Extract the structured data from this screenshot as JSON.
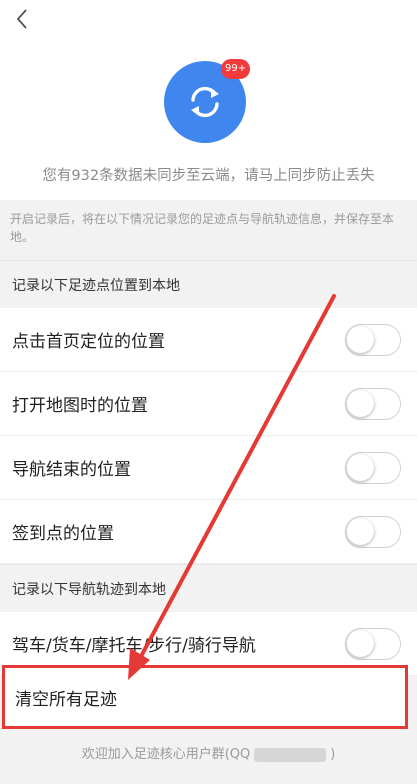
{
  "header": {
    "back_icon": "chevron-left-icon"
  },
  "sync": {
    "icon": "sync-icon",
    "badge": "99+",
    "message": "您有932条数据未同步至云端，请马上同步防止丢失"
  },
  "note": "开启记录后，将在以下情况记录您的足迹点与导航轨迹信息，并保存至本地。",
  "footprint_section": {
    "title": "记录以下足迹点位置到本地",
    "items": [
      {
        "label": "点击首页定位的位置",
        "on": false
      },
      {
        "label": "打开地图时的位置",
        "on": false
      },
      {
        "label": "导航结束的位置",
        "on": false
      },
      {
        "label": "签到点的位置",
        "on": false
      }
    ]
  },
  "track_section": {
    "title": "记录以下导航轨迹到本地",
    "items": [
      {
        "label": "驾车/货车/摩托车/步行/骑行导航",
        "on": false
      }
    ]
  },
  "clear": {
    "label": "清空所有足迹"
  },
  "footer": {
    "prefix": "欢迎加入足迹核心用户群(QQ",
    "suffix": ")"
  },
  "colors": {
    "accent": "#3f87ee",
    "badge": "#f43b3b",
    "annotation": "#e53935"
  }
}
